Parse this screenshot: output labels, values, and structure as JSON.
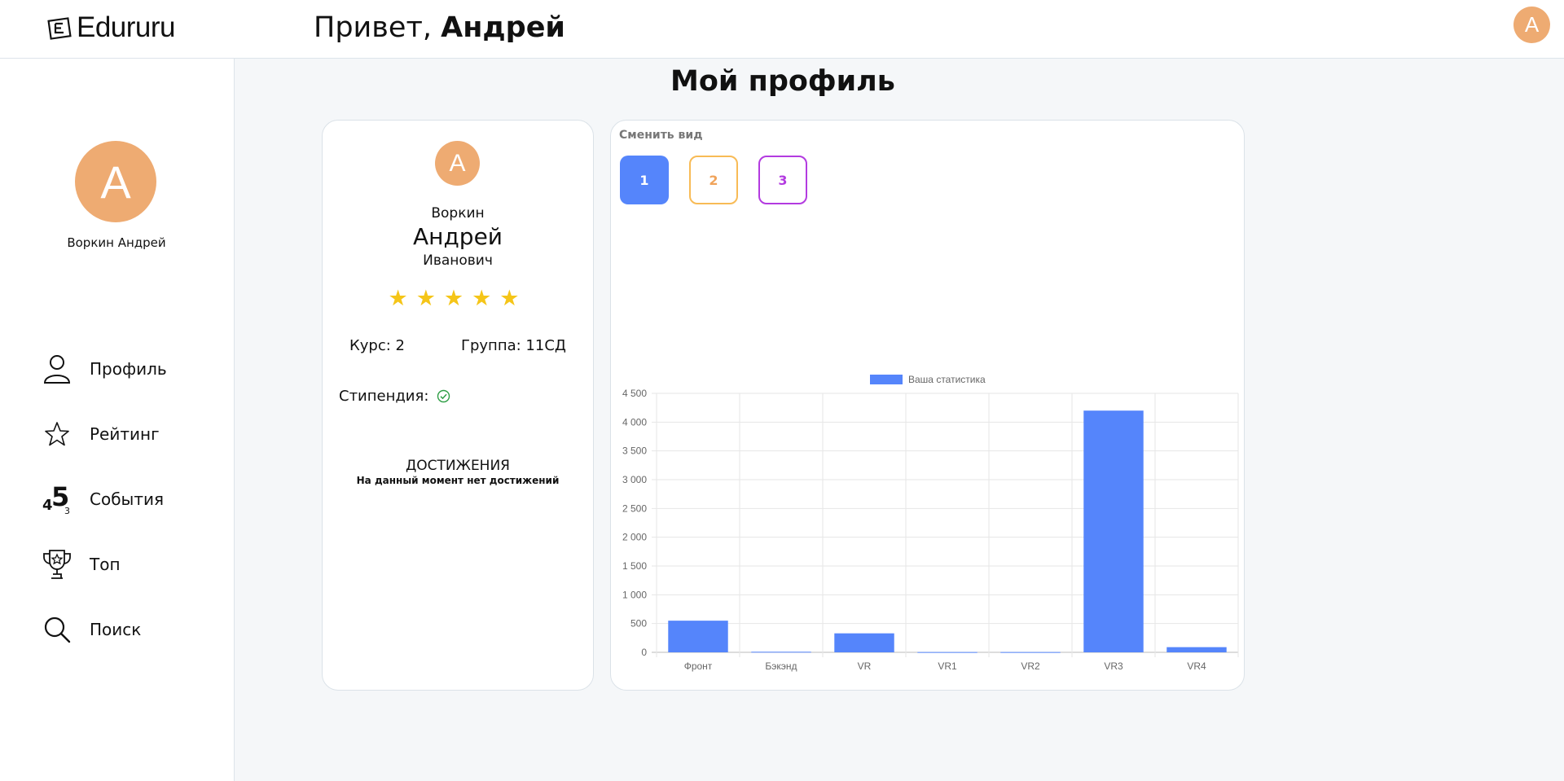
{
  "app": {
    "name": "Edururu"
  },
  "header": {
    "greeting_prefix": "Привет,",
    "greeting_name": "Андрей",
    "avatar_letter": "A"
  },
  "sidebar": {
    "avatar_letter": "A",
    "user_name": "Воркин Андрей",
    "items": [
      {
        "label": "Профиль",
        "icon": "user-icon"
      },
      {
        "label": "Рейтинг",
        "icon": "star-icon"
      },
      {
        "label": "События",
        "icon": "events-icon"
      },
      {
        "label": "Топ",
        "icon": "trophy-icon"
      },
      {
        "label": "Поиск",
        "icon": "search-icon"
      }
    ]
  },
  "main": {
    "title": "Мой профиль"
  },
  "profile": {
    "avatar_letter": "A",
    "surname": "Воркин",
    "name": "Андрей",
    "patronymic": "Иванович",
    "rating_stars": 5,
    "stars_text": "★★★★★",
    "course_label": "Курс: 2",
    "group_label": "Группа: 11СД",
    "stipend_label": "Стипендия:",
    "stipend_status": "granted",
    "achievements_title": "ДОСТИЖЕНИЯ",
    "achievements_empty": "На данный момент нет достижений"
  },
  "view_switch": {
    "label": "Сменить вид",
    "buttons": [
      "1",
      "2",
      "3"
    ],
    "selected": "1"
  },
  "colors": {
    "accent": "#5585fb",
    "avatar": "#eeab72",
    "star": "#f5c518",
    "view2": "#f8bb56",
    "view3": "#b33be0",
    "check": "#2e9e45"
  },
  "chart_data": {
    "type": "bar",
    "categories": [
      "Фронт",
      "Бэкэнд",
      "VR",
      "VR1",
      "VR2",
      "VR3",
      "VR4"
    ],
    "series": [
      {
        "name": "Ваша статистика",
        "values": [
          550,
          10,
          330,
          5,
          5,
          4200,
          90
        ],
        "color": "#5585fb"
      }
    ],
    "ylim": [
      0,
      4500
    ],
    "yticks": [
      0,
      500,
      1000,
      1500,
      2000,
      2500,
      3000,
      3500,
      4000,
      4500
    ],
    "ytick_labels": [
      "0",
      "500",
      "1 000",
      "1 500",
      "2 000",
      "2 500",
      "3 000",
      "3 500",
      "4 000",
      "4 500"
    ],
    "legend_position": "top",
    "grid": true
  }
}
